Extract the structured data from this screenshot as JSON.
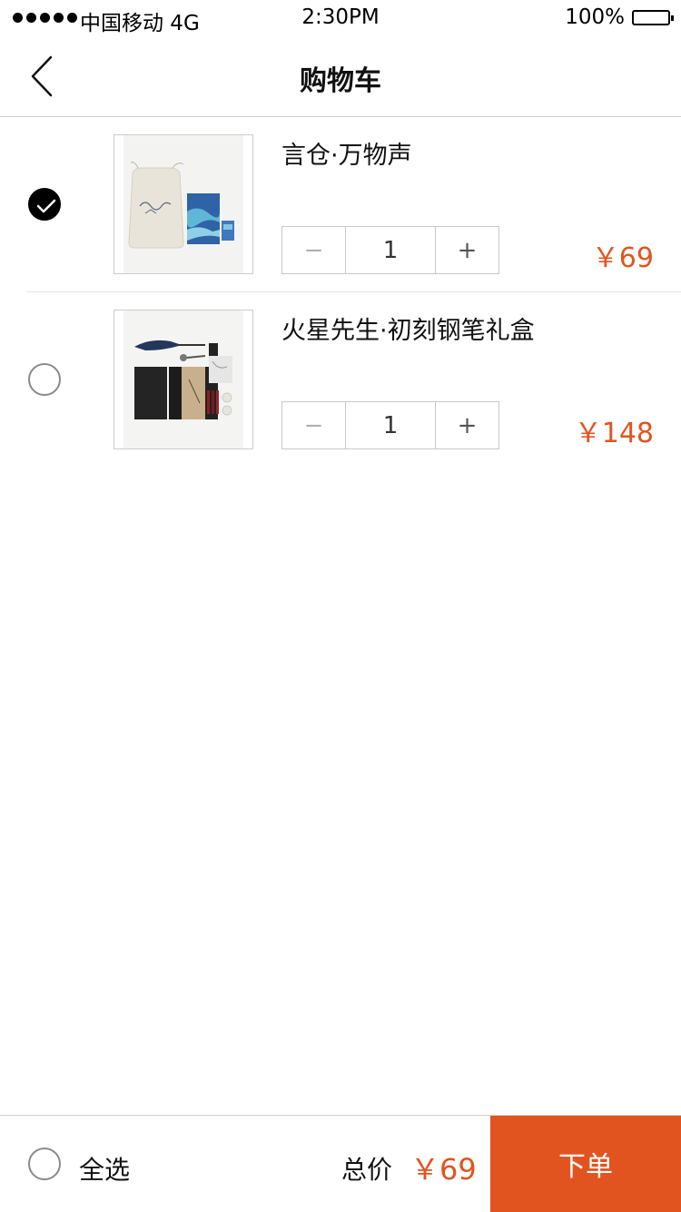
{
  "status_bar": {
    "carrier": "中国移动 4G",
    "time": "2:30PM",
    "battery": "100%"
  },
  "nav": {
    "title": "购物车"
  },
  "items": [
    {
      "name": "言仓·万物声",
      "quantity": "1",
      "price": "￥69",
      "selected": true,
      "minus_label": "−",
      "plus_label": "+"
    },
    {
      "name": "火星先生·初刻钢笔礼盒",
      "quantity": "1",
      "price": "￥148",
      "selected": false,
      "minus_label": "−",
      "plus_label": "+"
    }
  ],
  "footer": {
    "select_all_label": "全选",
    "total_label": "总价",
    "total_price": "￥69",
    "checkout_label": "下单"
  },
  "colors": {
    "accent": "#e2541f",
    "selected": "#000000"
  }
}
